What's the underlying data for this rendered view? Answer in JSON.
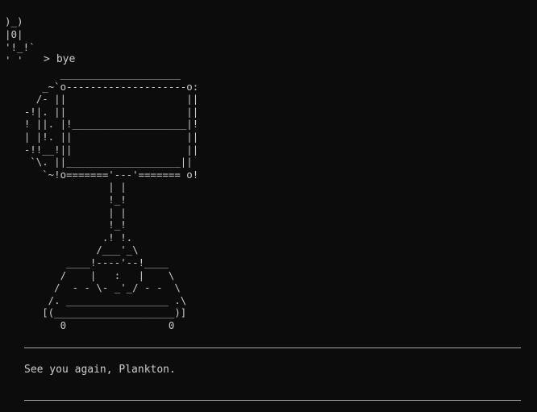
{
  "terminal": {
    "background": "#0c0c0c",
    "foreground": "#cccccc"
  },
  "top_art": ")_)\n|0|\n'!_!`\n' '",
  "prompt": {
    "symbol": ">",
    "command": "bye"
  },
  "ascii_art": "          ____________________\n       _~`o--------------------o:\n      /- ||                    ||\n    -!|. ||                    ||\n    ! ||. |!___________________|!\n    | |!. ||                   ||\n    -!!__!||                   ||\n     `\\. ||___________________||\n       `~!o======='---'======= o!\n                  | |\n                  !_!\n                  | |\n                  !_!\n                 .! !.\n                /___'_\\\n           ____!----'--!____\n          /    |   :   |    \\\n         /  - - \\- _'_/ - -  \\\n        /. _________________ .\\\n       [(____________________)]\n          0                 0",
  "message": "See you again, Plankton."
}
